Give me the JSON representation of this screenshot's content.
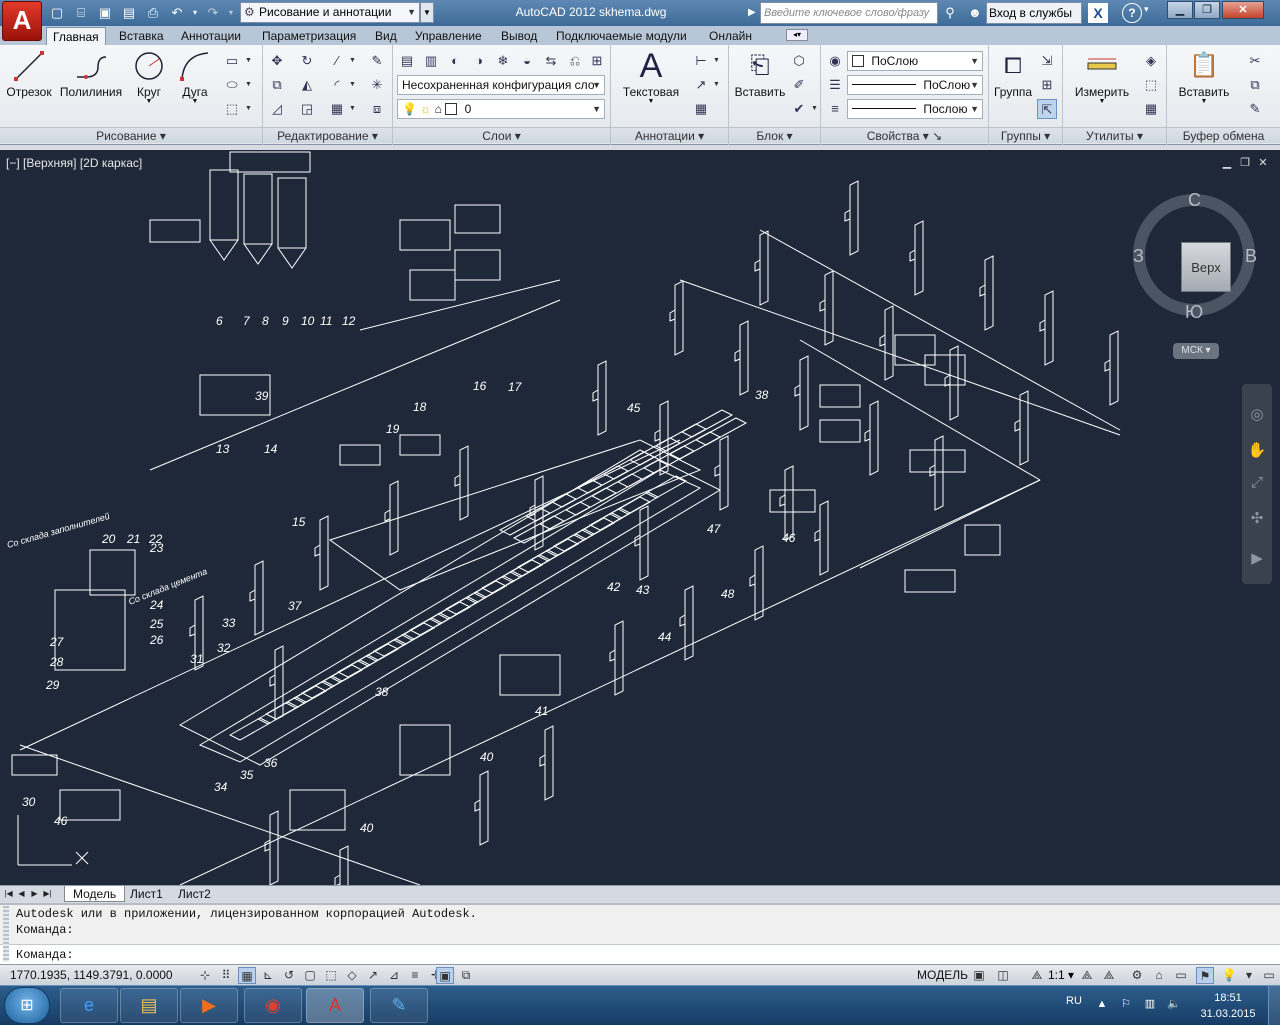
{
  "titlebar": {
    "workspace": "Рисование и аннотации",
    "title": "AutoCAD 2012    skhema.dwg",
    "search_placeholder": "Введите ключевое слово/фразу",
    "login": "Вход в службы"
  },
  "tabs": [
    "Главная",
    "Вставка",
    "Аннотации",
    "Параметризация",
    "Вид",
    "Управление",
    "Вывод",
    "Подключаемые модули",
    "Онлайн"
  ],
  "ribbon": {
    "draw": {
      "title": "Рисование",
      "line": "Отрезок",
      "polyline": "Полилиния",
      "circle": "Круг",
      "arc": "Дуга"
    },
    "modify": {
      "title": "Редактирование"
    },
    "layers": {
      "title": "Слои",
      "state": "Несохраненная конфигурация сло",
      "current": "0"
    },
    "annotation": {
      "title": "Аннотации",
      "text": "Текстовая"
    },
    "block": {
      "title": "Блок",
      "insert": "Вставить"
    },
    "properties": {
      "title": "Свойства",
      "color": "ПоСлою",
      "linetype": "ПоСлою",
      "lineweight": "Послою"
    },
    "groups": {
      "title": "Группы",
      "group": "Группа"
    },
    "utilities": {
      "title": "Утилиты",
      "measure": "Измерить"
    },
    "clipboard": {
      "title": "Буфер обмена",
      "paste": "Вставить"
    }
  },
  "viewport": {
    "label": "[−] [Верхняя] [2D каркас]",
    "viewcube": {
      "face": "Верх",
      "north": "С",
      "south": "Ю",
      "west": "З",
      "east": "В"
    },
    "ucs": "МСК"
  },
  "drawing": {
    "labels": [
      "6",
      "7",
      "8",
      "9",
      "10",
      "11",
      "12",
      "13",
      "14",
      "15",
      "16",
      "17",
      "18",
      "19",
      "20",
      "21",
      "22",
      "23",
      "24",
      "25",
      "26",
      "27",
      "28",
      "29",
      "30",
      "31",
      "32",
      "33",
      "34",
      "35",
      "36",
      "37",
      "38",
      "38",
      "39",
      "40",
      "40",
      "41",
      "42",
      "43",
      "44",
      "45",
      "46",
      "46",
      "47",
      "48"
    ],
    "annotations": [
      "Со склада заполнителей",
      "Со склада цемента"
    ]
  },
  "layout_tabs": [
    "Модель",
    "Лист1",
    "Лист2"
  ],
  "command": {
    "history_1": "Autodesk или в приложении, лицензированном корпорацией Autodesk.",
    "history_2": "Команда:",
    "prompt": "Команда:"
  },
  "status": {
    "coords": "1770.1935, 1149.3791, 0.0000",
    "model": "МОДЕЛЬ",
    "scale": "1:1"
  },
  "taskbar": {
    "lang": "RU",
    "time": "18:51",
    "date": "31.03.2015"
  },
  "colors": {
    "canvas": "#1f2838",
    "linework": "#ffffff",
    "titlebar": "#4a77a6",
    "taskbar": "#1f4a78"
  }
}
